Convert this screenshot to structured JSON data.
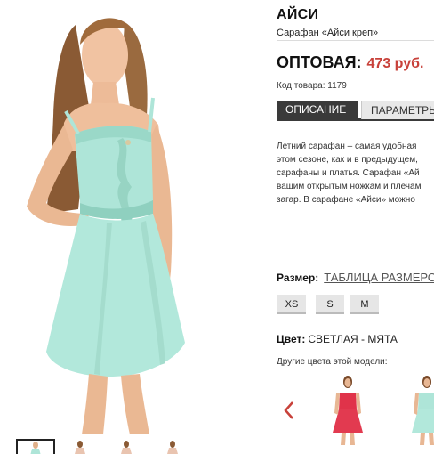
{
  "product": {
    "title": "АЙСИ",
    "subtitle": "Сарафан «Айси креп»",
    "price_label": "ОПТОВАЯ:",
    "price_value": "473 руб.",
    "code": "Код товара: 1179"
  },
  "tabs": [
    {
      "label": "ОПИСАНИЕ"
    },
    {
      "label": "ПАРАМЕТРЫ"
    }
  ],
  "description_lines": [
    "Летний сарафан – самая удобная",
    "этом сезоне, как и в предыдущем,",
    "сарафаны и платья. Сарафан «Ай",
    "вашим открытым ножкам и плечам",
    "загар. В сарафане «Айси» можно"
  ],
  "size": {
    "label": "Размер:",
    "table_link": "ТАБЛИЦА РАЗМЕРОВ",
    "options": [
      "XS",
      "S",
      "M"
    ]
  },
  "color": {
    "label": "Цвет:",
    "value": "СВЕТЛАЯ - МЯТА",
    "other_label": "Другие цвета этой модели:"
  },
  "icons": {
    "arrow": "chevron-left-icon"
  },
  "colors": {
    "accent_price": "#c8413a",
    "tab_active": "#3a3a3a",
    "dress_main": "#aee5d8",
    "dress_variant_red": "#e0334a"
  }
}
